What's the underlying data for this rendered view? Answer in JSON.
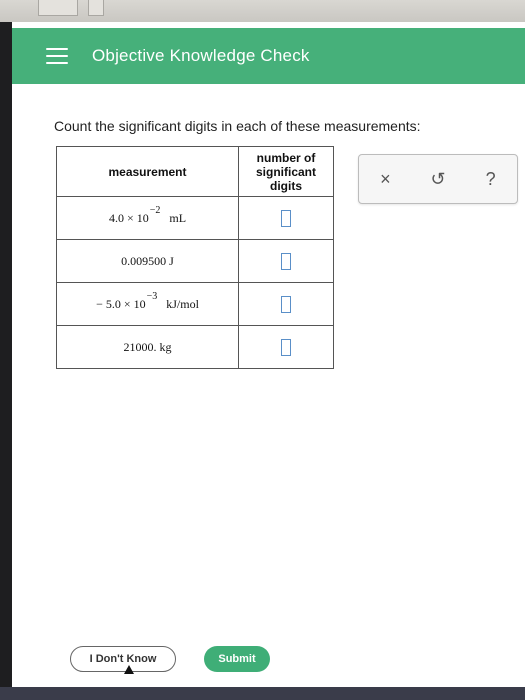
{
  "header": {
    "title": "Objective Knowledge Check"
  },
  "question": "Count the significant digits in each of these measurements:",
  "table": {
    "headers": [
      "measurement",
      "number of significant digits"
    ],
    "rows": [
      {
        "base": "4.0 × 10",
        "exp": "−2",
        "unit": "mL"
      },
      {
        "base": "0.009500 J",
        "exp": "",
        "unit": ""
      },
      {
        "base": "− 5.0 × 10",
        "exp": "−3",
        "unit": "kJ/mol"
      },
      {
        "base": "21000. kg",
        "exp": "",
        "unit": ""
      }
    ]
  },
  "tools": {
    "clear": "×",
    "undo": "↺",
    "help": "?"
  },
  "buttons": {
    "dont_know": "I Don't Know",
    "submit": "Submit"
  }
}
